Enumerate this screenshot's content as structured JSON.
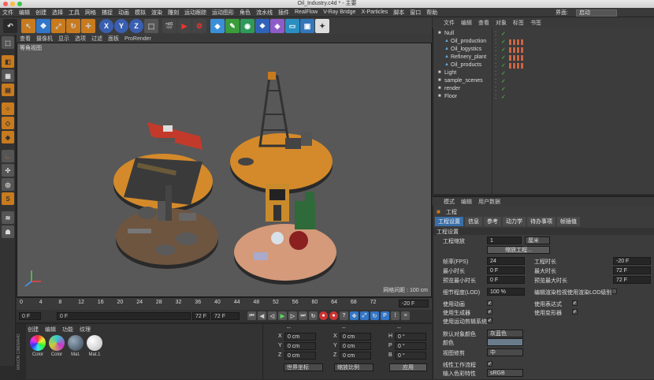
{
  "window": {
    "title": "Oil_Industry.c4d * - 主要"
  },
  "menu": {
    "items": [
      "文件",
      "编辑",
      "创建",
      "选择",
      "工具",
      "网格",
      "捕捉",
      "动画",
      "模拟",
      "渲染",
      "雕刻",
      "运动跟踪",
      "运动图形",
      "角色",
      "流水线",
      "插件",
      "RealFlow",
      "V-Ray Bridge",
      "X-Particles",
      "脚本",
      "窗口",
      "帮助"
    ],
    "layout_label": "界面:",
    "layout_value": "启动"
  },
  "viewport": {
    "menu": [
      "查看",
      "摄像机",
      "显示",
      "选项",
      "过滤",
      "面板",
      "ProRender"
    ],
    "label": "等角视图",
    "grid": "网格间距 : 100 cm"
  },
  "timeline": {
    "ticks": [
      "0",
      "4",
      "8",
      "12",
      "16",
      "20",
      "24",
      "28",
      "32",
      "36",
      "40",
      "44",
      "48",
      "52",
      "56",
      "60",
      "64",
      "68",
      "72"
    ],
    "end_frame": "-20 F"
  },
  "transport": {
    "start": "0 F",
    "mid": "0 F",
    "end": "72 F",
    "end2": "72 F"
  },
  "materials": {
    "menu": [
      "创建",
      "编辑",
      "功能",
      "纹理"
    ],
    "items": [
      "Color",
      "Color",
      "Mat.",
      "Mat.1"
    ],
    "brand": "MAXON CINEMA4D"
  },
  "coords": {
    "header": [
      "--",
      "--",
      "--"
    ],
    "rows": [
      {
        "a": "X",
        "v1": "0 cm",
        "b": "X",
        "v2": "0 cm",
        "c": "H",
        "v3": "0 °"
      },
      {
        "a": "Y",
        "v1": "0 cm",
        "b": "Y",
        "v2": "0 cm",
        "c": "P",
        "v3": "0 °"
      },
      {
        "a": "Z",
        "v1": "0 cm",
        "b": "Z",
        "v2": "0 cm",
        "c": "B",
        "v3": "0 °"
      }
    ],
    "world": "世界坐标",
    "scale": "缩放比例",
    "apply": "应用"
  },
  "objects": {
    "menu": [
      "文件",
      "编辑",
      "查看",
      "对象",
      "标签",
      "书签"
    ],
    "items": [
      {
        "name": "Null",
        "indent": 0
      },
      {
        "name": "Oil_production",
        "indent": 1
      },
      {
        "name": "Oil_logystics",
        "indent": 1
      },
      {
        "name": "Refinery_plant",
        "indent": 1
      },
      {
        "name": "Oil_products",
        "indent": 1
      },
      {
        "name": "Light",
        "indent": 0
      },
      {
        "name": "sample_scenes",
        "indent": 0
      },
      {
        "name": "render",
        "indent": 0
      },
      {
        "name": "Floor",
        "indent": 0
      }
    ]
  },
  "attributes": {
    "menu": [
      "模式",
      "编辑",
      "用户数据"
    ],
    "title": "工程",
    "tabs": [
      "工程设置",
      "信息",
      "参考",
      "动力学",
      "待办事项",
      "帧插值"
    ],
    "section": "工程设置",
    "scale_label": "工程缩放",
    "scale_value": "1",
    "scale_unit": "厘米",
    "scale_btn": "缩放工程...",
    "fps_label": "帧率(FPS)",
    "fps_value": "24",
    "duration_label": "工程时长",
    "duration_value": "-20 F",
    "min_label": "最小时长",
    "min_value": "0 F",
    "max_label": "最大时长",
    "max_value": "72 F",
    "pmin_label": "预览最小时长",
    "pmin_value": "0 F",
    "pmax_label": "预览最大时长",
    "pmax_value": "72 F",
    "lod_label": "细节程度(LOD)",
    "lod_value": "100 %",
    "lod_render": "编辑渲染检视使用渲染LOD级别",
    "anim": "使用动画",
    "expr": "使用表达式",
    "gen": "使用生成器",
    "deform": "使用变形器",
    "mograph": "使用运动剪辑系统",
    "defcolor_label": "默认对象颜色",
    "defcolor_value": "灰蓝色",
    "color_label": "颜色",
    "clip_label": "视图修剪",
    "clip_value": "中",
    "linear_label": "线性工作流程",
    "input_label": "输入色彩特性",
    "input_value": "sRGB"
  }
}
